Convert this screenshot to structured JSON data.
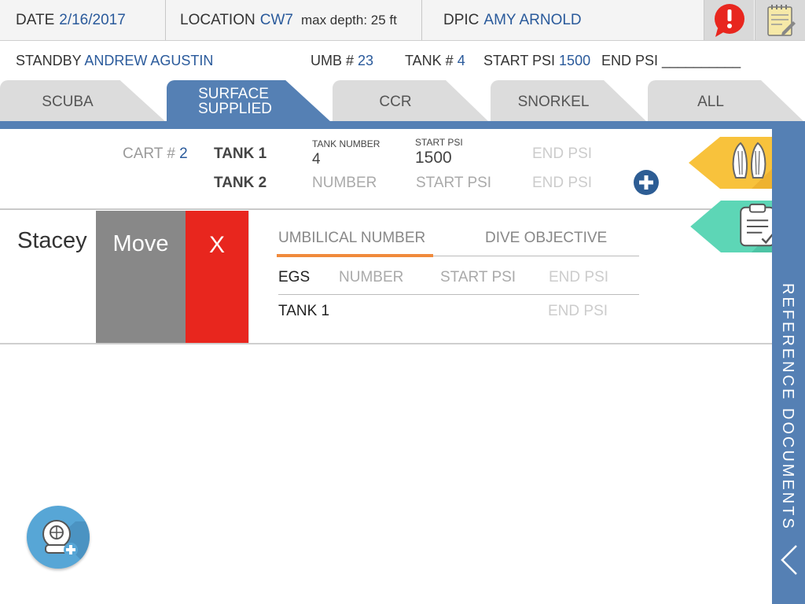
{
  "header": {
    "date_label": "DATE",
    "date_value": "2/16/2017",
    "location_label": "LOCATION",
    "location_value": "CW7",
    "max_depth": "max depth: 25 ft",
    "dpic_label": "DPIC",
    "dpic_value": "AMY ARNOLD"
  },
  "subheader": {
    "standby_label": "STANDBY",
    "standby_value": "ANDREW AGUSTIN",
    "umb_label": "UMB #",
    "umb_value": "23",
    "tank_label": "TANK #",
    "tank_value": "4",
    "start_psi_label": "START PSI",
    "start_psi_value": "1500",
    "end_psi_label": "END PSI",
    "end_psi_blank": "__________"
  },
  "tabs": [
    {
      "label": "SCUBA"
    },
    {
      "label": "SURFACE SUPPLIED"
    },
    {
      "label": "CCR"
    },
    {
      "label": "SNORKEL"
    },
    {
      "label": "ALL"
    }
  ],
  "active_tab": "SURFACE SUPPLIED",
  "cart": {
    "cart_label": "CART #",
    "cart_value": "2",
    "tank1_label": "TANK 1",
    "tank_number_caption": "TANK NUMBER",
    "tank1_number": "4",
    "start_psi_caption": "START PSI",
    "tank1_start_psi": "1500",
    "tank1_end_psi_placeholder": "END PSI",
    "tank2_label": "TANK 2",
    "tank2_number_placeholder": "NUMBER",
    "tank2_start_psi_placeholder": "START PSI",
    "tank2_end_psi_placeholder": "END PSI"
  },
  "diver": {
    "name": "Stacey",
    "move_label": "Move",
    "delete_label": "X",
    "umbilical_placeholder": "UMBILICAL NUMBER",
    "objective_placeholder": "DIVE OBJECTIVE",
    "egs_label": "EGS",
    "egs_number_placeholder": "NUMBER",
    "egs_start_psi_placeholder": "START PSI",
    "egs_end_psi_placeholder": "END PSI",
    "tank1_label": "TANK 1",
    "tank1_end_psi_placeholder": "END PSI"
  },
  "sidebar": {
    "label": "REFERENCE DOCUMENTS"
  },
  "icons": {
    "alert": "alert-icon",
    "notes": "notepad-icon",
    "fins": "fins-icon",
    "clipboard": "clipboard-icon",
    "add": "plus-circle-icon",
    "add_diver": "dive-helmet-icon",
    "chevron": "chevron-left-icon"
  },
  "colors": {
    "accent_blue": "#5580b4",
    "value_blue": "#2a5a9b",
    "alert_red": "#e8261e",
    "fins_yellow": "#f8c23c",
    "clipboard_teal": "#5dd6b6",
    "move_gray": "#888888",
    "underline_orange": "#f08a3c"
  }
}
